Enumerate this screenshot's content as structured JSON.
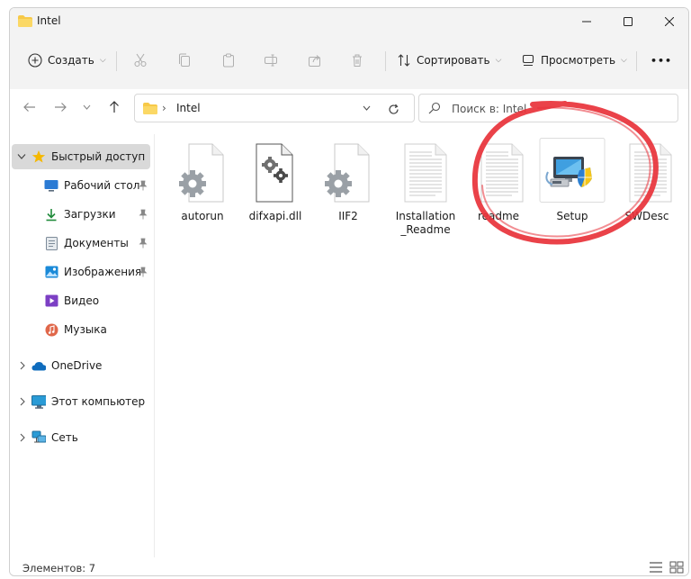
{
  "window": {
    "title": "Intel",
    "minimize_glyph": "—",
    "maximize_glyph": "☐",
    "close_glyph": "✕"
  },
  "toolbar": {
    "create_label": "Создать",
    "sort_label": "Сортировать",
    "view_label": "Просмотреть",
    "more_glyph": "•••",
    "caret": "⌵"
  },
  "address": {
    "path_segment": "Intel",
    "chevron": "›",
    "dropdown_glyph": "⌵"
  },
  "search": {
    "placeholder": "Поиск в: Intel"
  },
  "sidebar": {
    "quick_access": "Быстрый доступ",
    "items": [
      {
        "label": "Рабочий стол",
        "icon": "desktop-icon",
        "pinned": true
      },
      {
        "label": "Загрузки",
        "icon": "downloads-icon",
        "pinned": true
      },
      {
        "label": "Документы",
        "icon": "documents-icon",
        "pinned": true
      },
      {
        "label": "Изображения",
        "icon": "pictures-icon",
        "pinned": true
      },
      {
        "label": "Видео",
        "icon": "videos-icon",
        "pinned": false
      },
      {
        "label": "Музыка",
        "icon": "music-icon",
        "pinned": false
      }
    ],
    "onedrive": "OneDrive",
    "this_pc": "Этот компьютер",
    "network": "Сеть",
    "pin_glyph": "📌",
    "collapsed_glyph": "›",
    "expanded_glyph": "⌵"
  },
  "files": [
    {
      "name": "autorun",
      "icon": "settings-file-icon"
    },
    {
      "name": "difxapi.dll",
      "icon": "dll-file-icon"
    },
    {
      "name": "IIF2",
      "icon": "settings-file-icon"
    },
    {
      "name": "Installation_Readme",
      "icon": "text-file-icon"
    },
    {
      "name": "readme",
      "icon": "text-file-icon"
    },
    {
      "name": "Setup",
      "icon": "setup-exe-icon"
    },
    {
      "name": "SWDesc",
      "icon": "text-file-icon"
    }
  ],
  "status": {
    "item_count": "Элементов: 7"
  },
  "colors": {
    "chrome_bg": "#f3f3f3",
    "folder_yellow": "#f7c948",
    "accent_blue": "#0067c0",
    "annotation_red": "#e8323a",
    "selected_nav": "#d9d9d9"
  }
}
